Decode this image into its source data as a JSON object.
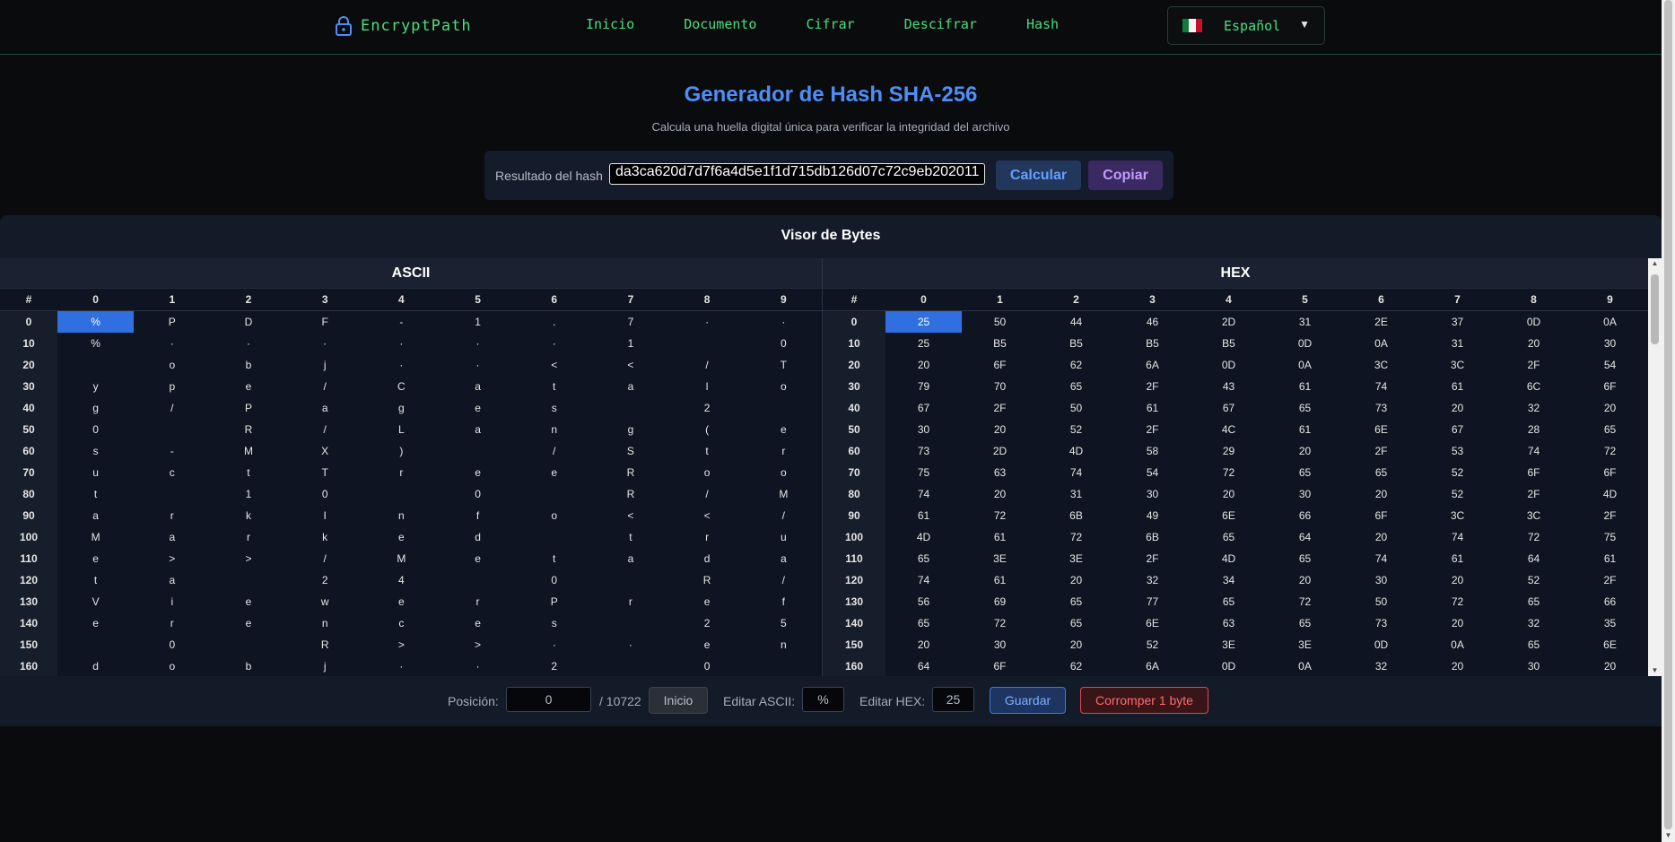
{
  "nav": {
    "brand": "EncryptPath",
    "links": [
      "Inicio",
      "Documento",
      "Cifrar",
      "Descifrar",
      "Hash"
    ],
    "language": "Español"
  },
  "header": {
    "title": "Generador de Hash SHA-256",
    "subtitle": "Calcula una huella digital única para verificar la integridad del archivo"
  },
  "hash": {
    "label": "Resultado del hash",
    "value": "da3ca620d7d7f6a4d5e1f1d715db126d07c72c9eb202011",
    "calc_label": "Calcular",
    "copy_label": "Copiar"
  },
  "viewer": {
    "title": "Visor de Bytes",
    "ascii_title": "ASCII",
    "hex_title": "HEX",
    "col_headers": [
      "#",
      "0",
      "1",
      "2",
      "3",
      "4",
      "5",
      "6",
      "7",
      "8",
      "9"
    ],
    "selected_offset": 0,
    "rows": [
      {
        "offset": "0",
        "ascii": [
          "%",
          "P",
          "D",
          "F",
          "-",
          "1",
          ".",
          "7",
          "·",
          "·"
        ],
        "hex": [
          "25",
          "50",
          "44",
          "46",
          "2D",
          "31",
          "2E",
          "37",
          "0D",
          "0A"
        ]
      },
      {
        "offset": "10",
        "ascii": [
          "%",
          "·",
          "·",
          "·",
          "·",
          "·",
          "·",
          "1",
          "",
          "0"
        ],
        "hex": [
          "25",
          "B5",
          "B5",
          "B5",
          "B5",
          "0D",
          "0A",
          "31",
          "20",
          "30"
        ]
      },
      {
        "offset": "20",
        "ascii": [
          "",
          "o",
          "b",
          "j",
          "·",
          "·",
          "<",
          "<",
          "/",
          "T"
        ],
        "hex": [
          "20",
          "6F",
          "62",
          "6A",
          "0D",
          "0A",
          "3C",
          "3C",
          "2F",
          "54"
        ]
      },
      {
        "offset": "30",
        "ascii": [
          "y",
          "p",
          "e",
          "/",
          "C",
          "a",
          "t",
          "a",
          "l",
          "o"
        ],
        "hex": [
          "79",
          "70",
          "65",
          "2F",
          "43",
          "61",
          "74",
          "61",
          "6C",
          "6F"
        ]
      },
      {
        "offset": "40",
        "ascii": [
          "g",
          "/",
          "P",
          "a",
          "g",
          "e",
          "s",
          "",
          "2",
          ""
        ],
        "hex": [
          "67",
          "2F",
          "50",
          "61",
          "67",
          "65",
          "73",
          "20",
          "32",
          "20"
        ]
      },
      {
        "offset": "50",
        "ascii": [
          "0",
          "",
          "R",
          "/",
          "L",
          "a",
          "n",
          "g",
          "(",
          "e"
        ],
        "hex": [
          "30",
          "20",
          "52",
          "2F",
          "4C",
          "61",
          "6E",
          "67",
          "28",
          "65"
        ]
      },
      {
        "offset": "60",
        "ascii": [
          "s",
          "-",
          "M",
          "X",
          ")",
          "",
          "/",
          "S",
          "t",
          "r"
        ],
        "hex": [
          "73",
          "2D",
          "4D",
          "58",
          "29",
          "20",
          "2F",
          "53",
          "74",
          "72"
        ]
      },
      {
        "offset": "70",
        "ascii": [
          "u",
          "c",
          "t",
          "T",
          "r",
          "e",
          "e",
          "R",
          "o",
          "o"
        ],
        "hex": [
          "75",
          "63",
          "74",
          "54",
          "72",
          "65",
          "65",
          "52",
          "6F",
          "6F"
        ]
      },
      {
        "offset": "80",
        "ascii": [
          "t",
          "",
          "1",
          "0",
          "",
          "0",
          "",
          "R",
          "/",
          "M"
        ],
        "hex": [
          "74",
          "20",
          "31",
          "30",
          "20",
          "30",
          "20",
          "52",
          "2F",
          "4D"
        ]
      },
      {
        "offset": "90",
        "ascii": [
          "a",
          "r",
          "k",
          "I",
          "n",
          "f",
          "o",
          "<",
          "<",
          "/"
        ],
        "hex": [
          "61",
          "72",
          "6B",
          "49",
          "6E",
          "66",
          "6F",
          "3C",
          "3C",
          "2F"
        ]
      },
      {
        "offset": "100",
        "ascii": [
          "M",
          "a",
          "r",
          "k",
          "e",
          "d",
          "",
          "t",
          "r",
          "u"
        ],
        "hex": [
          "4D",
          "61",
          "72",
          "6B",
          "65",
          "64",
          "20",
          "74",
          "72",
          "75"
        ]
      },
      {
        "offset": "110",
        "ascii": [
          "e",
          ">",
          ">",
          "/",
          "M",
          "e",
          "t",
          "a",
          "d",
          "a"
        ],
        "hex": [
          "65",
          "3E",
          "3E",
          "2F",
          "4D",
          "65",
          "74",
          "61",
          "64",
          "61"
        ]
      },
      {
        "offset": "120",
        "ascii": [
          "t",
          "a",
          "",
          "2",
          "4",
          "",
          "0",
          "",
          "R",
          "/"
        ],
        "hex": [
          "74",
          "61",
          "20",
          "32",
          "34",
          "20",
          "30",
          "20",
          "52",
          "2F"
        ]
      },
      {
        "offset": "130",
        "ascii": [
          "V",
          "i",
          "e",
          "w",
          "e",
          "r",
          "P",
          "r",
          "e",
          "f"
        ],
        "hex": [
          "56",
          "69",
          "65",
          "77",
          "65",
          "72",
          "50",
          "72",
          "65",
          "66"
        ]
      },
      {
        "offset": "140",
        "ascii": [
          "e",
          "r",
          "e",
          "n",
          "c",
          "e",
          "s",
          "",
          "2",
          "5"
        ],
        "hex": [
          "65",
          "72",
          "65",
          "6E",
          "63",
          "65",
          "73",
          "20",
          "32",
          "35"
        ]
      },
      {
        "offset": "150",
        "ascii": [
          "",
          "0",
          "",
          "R",
          ">",
          ">",
          "·",
          "·",
          "e",
          "n"
        ],
        "hex": [
          "20",
          "30",
          "20",
          "52",
          "3E",
          "3E",
          "0D",
          "0A",
          "65",
          "6E"
        ]
      },
      {
        "offset": "160",
        "ascii": [
          "d",
          "o",
          "b",
          "j",
          "·",
          "·",
          "2",
          "",
          "0",
          ""
        ],
        "hex": [
          "64",
          "6F",
          "62",
          "6A",
          "0D",
          "0A",
          "32",
          "20",
          "30",
          "20"
        ]
      }
    ]
  },
  "controls": {
    "position_label": "Posición:",
    "position_value": "0",
    "total": "/ 10722",
    "inicio_label": "Inicio",
    "edit_ascii_label": "Editar ASCII:",
    "edit_ascii_value": "%",
    "edit_hex_label": "Editar HEX:",
    "edit_hex_value": "25",
    "save_label": "Guardar",
    "corrupt_label": "Corromper 1 byte"
  },
  "colors": {
    "accent_green": "#4ade80",
    "accent_blue": "#4f8ef7",
    "selection": "#2f6fe0",
    "danger": "#ff6b6b"
  }
}
